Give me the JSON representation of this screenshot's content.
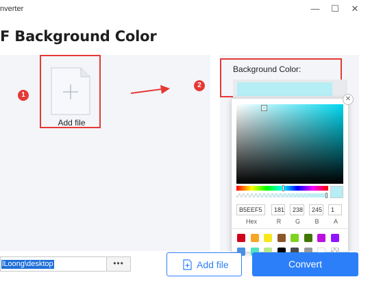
{
  "window": {
    "title": "nverter",
    "minimize_glyph": "—",
    "maximize_glyph": "☐",
    "close_glyph": "✕"
  },
  "page": {
    "title": "F Background Color"
  },
  "steps": {
    "one": "1",
    "two": "2"
  },
  "drop_area": {
    "add_file_label": "Add file"
  },
  "background": {
    "label": "Background Color:",
    "current_color": "#B5EEF5"
  },
  "picker": {
    "close_glyph": "✕",
    "hex": "B5EEF5",
    "r": "181",
    "g": "238",
    "b": "245",
    "a": "1",
    "labels": {
      "hex": "Hex",
      "r": "R",
      "g": "G",
      "b": "B",
      "a": "A"
    },
    "hue_color": "#00d8f0",
    "presets": [
      "#d0021b",
      "#f5a623",
      "#f8e71c",
      "#8b572a",
      "#7ed321",
      "#417505",
      "#bd10e0",
      "#9013fe",
      "#4a90e2",
      "#50e3c2",
      "#b8e986",
      "#000000",
      "#4a4a4a",
      "#9b9b9b",
      "#ffffff",
      "transparent"
    ]
  },
  "footer": {
    "path_value": "lLoong\\desktop",
    "more_label": "•••",
    "add_file_button": "Add file",
    "convert_button": "Convert"
  },
  "colors": {
    "accent": "#2d7ff9",
    "annotation_red": "#e53935"
  }
}
